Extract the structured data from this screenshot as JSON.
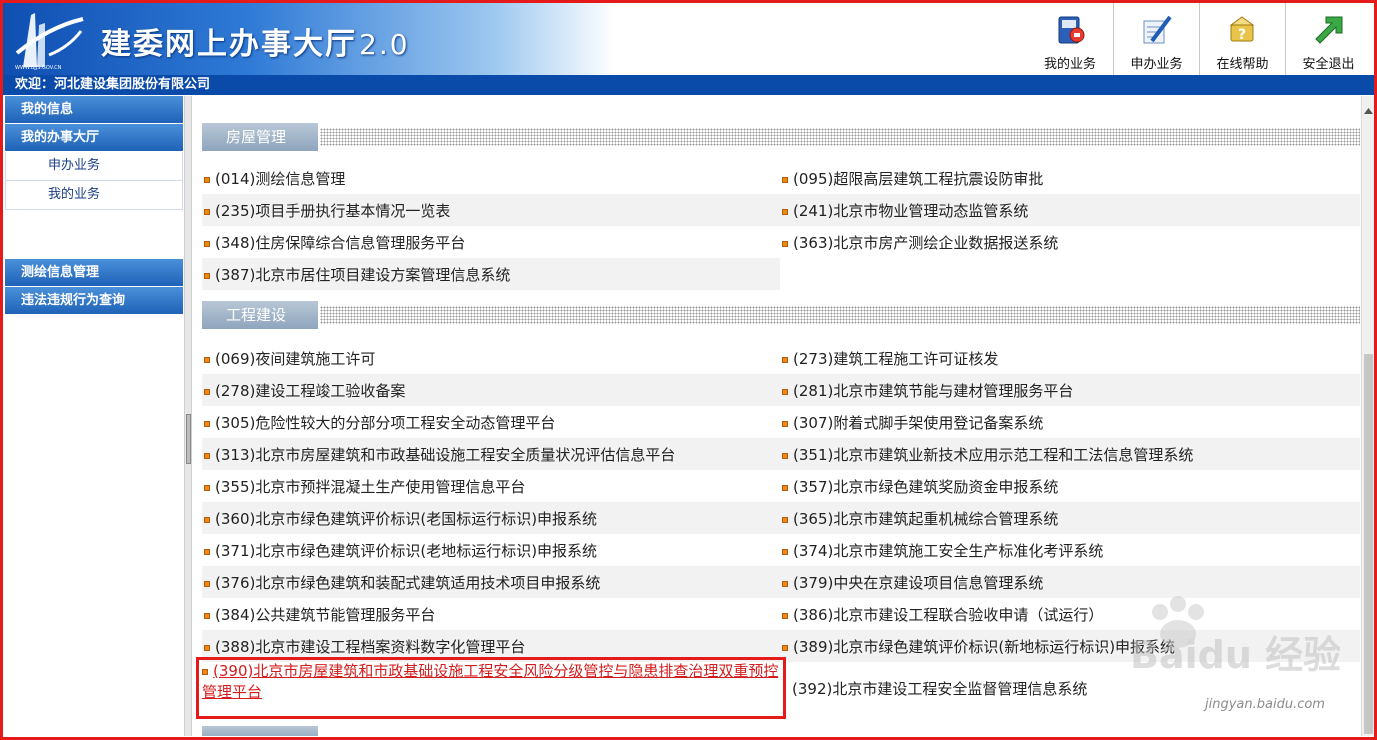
{
  "header": {
    "title": "建委网上办事大厅",
    "version": "2.0",
    "logo_text": "WWW.BJJS.GOV.CN",
    "toolbar": [
      {
        "label": "我的业务",
        "icon": "book-icon"
      },
      {
        "label": "申办业务",
        "icon": "pen-icon"
      },
      {
        "label": "在线帮助",
        "icon": "question-icon"
      },
      {
        "label": "安全退出",
        "icon": "exit-arrow-icon"
      }
    ]
  },
  "welcome": "欢迎：河北建设集团股份有限公司",
  "sidebar": {
    "my_info": "我的信息",
    "my_hall": "我的办事大厅",
    "sub_apply": "申办业务",
    "sub_mine": "我的业务",
    "survey": "测绘信息管理",
    "violation": "违法违规行为查询"
  },
  "sections": {
    "housing": "房屋管理",
    "engineering": "工程建设"
  },
  "housing_items": [
    "(014)测绘信息管理",
    "(095)超限高层建筑工程抗震设防审批",
    "(235)项目手册执行基本情况一览表",
    "(241)北京市物业管理动态监管系统",
    "(348)住房保障综合信息管理服务平台",
    "(363)北京市房产测绘企业数据报送系统",
    "(387)北京市居住项目建设方案管理信息系统"
  ],
  "engineering_items": [
    "(069)夜间建筑施工许可",
    "(273)建筑工程施工许可证核发",
    "(278)建设工程竣工验收备案",
    "(281)北京市建筑节能与建材管理服务平台",
    "(305)危险性较大的分部分项工程安全动态管理平台",
    "(307)附着式脚手架使用登记备案系统",
    "(313)北京市房屋建筑和市政基础设施工程安全质量状况评估信息平台",
    "(351)北京市建筑业新技术应用示范工程和工法信息管理系统",
    "(355)北京市预拌混凝土生产使用管理信息平台",
    "(357)北京市绿色建筑奖励资金申报系统",
    "(360)北京市绿色建筑评价标识(老国标运行标识)申报系统",
    "(365)北京市建筑起重机械综合管理系统",
    "(371)北京市绿色建筑评价标识(老地标运行标识)申报系统",
    "(374)北京市建筑施工安全生产标准化考评系统",
    "(376)北京市绿色建筑和装配式建筑适用技术项目申报系统",
    "(379)中央在京建设项目信息管理系统",
    "(384)公共建筑节能管理服务平台",
    "(386)北京市建设工程联合验收申请（试运行）",
    "(388)北京市建设工程档案资料数字化管理平台",
    "(389)北京市绿色建筑评价标识(新地标运行标识)申报系统",
    "(390)北京市房屋建筑和市政基础设施工程安全风险分级管控与隐患排查治理双重预控管理平台",
    "(392)北京市建设工程安全监督管理信息系统"
  ],
  "watermark": {
    "brand": "Baidu 经验",
    "url": "jingyan.baidu.com"
  },
  "colors": {
    "header_blue": "#0a4aa8",
    "highlight_red": "#e51b1b",
    "bullet_orange": "#e88a1a",
    "section_tab": "#9db0c4"
  }
}
